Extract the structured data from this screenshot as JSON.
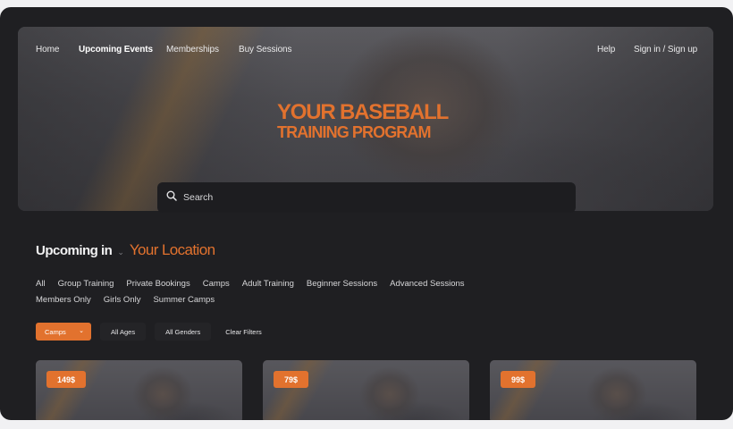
{
  "nav": {
    "home": "Home",
    "upcoming_events": "Upcoming Events",
    "memberships": "Memberships",
    "buy_sessions": "Buy Sessions",
    "help": "Help",
    "sign_in": "Sign in / Sign up"
  },
  "hero": {
    "title_line1": "YOUR BASEBALL",
    "title_line2": "TRAINING PROGRAM"
  },
  "search": {
    "placeholder": "Search"
  },
  "upcoming": {
    "label": "Upcoming in",
    "location": "Your Location"
  },
  "categories": {
    "row1": [
      "All",
      "Group Training",
      "Private Bookings",
      "Camps",
      "Adult Training",
      "Beginner Sessions",
      "Advanced Sessions"
    ],
    "row2": [
      "Members Only",
      "Girls Only",
      "Summer Camps"
    ]
  },
  "filters": {
    "type": "Camps",
    "ages": "All Ages",
    "genders": "All Genders",
    "clear": "Clear Filters"
  },
  "cards": [
    {
      "price": "149$"
    },
    {
      "price": "79$"
    },
    {
      "price": "99$"
    }
  ],
  "colors": {
    "accent": "#e2722e",
    "background": "#1f1f22"
  }
}
